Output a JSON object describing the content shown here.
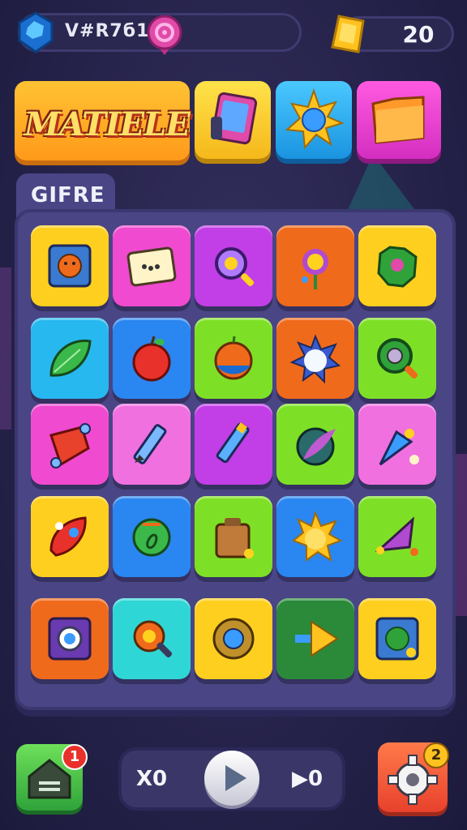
{
  "hud": {
    "player_code": "V#R7б1",
    "coins": "20"
  },
  "header": {
    "title": "MATIELE",
    "tabs": [
      {
        "icon": "tablet-icon",
        "color": "#ffd21f"
      },
      {
        "icon": "sun-icon",
        "color": "#2fb8f0"
      },
      {
        "icon": "folder-icon",
        "color": "#f04ad0"
      }
    ]
  },
  "panel": {
    "label": "GIFRE"
  },
  "grid": {
    "tiles": [
      {
        "icon": "monster-card-icon",
        "color": "#ffcf1f"
      },
      {
        "icon": "card-icon",
        "color": "#f04ad0"
      },
      {
        "icon": "magnifier-icon",
        "color": "#c23ee6"
      },
      {
        "icon": "flower-icon",
        "color": "#f06a1c"
      },
      {
        "icon": "green-monster-icon",
        "color": "#ffcf1f"
      },
      {
        "icon": "leaf-icon",
        "color": "#27b8f0"
      },
      {
        "icon": "apple-icon",
        "color": "#2a86f0"
      },
      {
        "icon": "tomato-icon",
        "color": "#7ee026"
      },
      {
        "icon": "star-burst-icon",
        "color": "#f06a1c"
      },
      {
        "icon": "green-magnifier-icon",
        "color": "#7ee026"
      },
      {
        "icon": "diamond-icon",
        "color": "#f04ad0"
      },
      {
        "icon": "pencil-icon",
        "color": "#f070e0"
      },
      {
        "icon": "blue-pencil-icon",
        "color": "#c23ee6"
      },
      {
        "icon": "feather-icon",
        "color": "#7ee026"
      },
      {
        "icon": "cone-icon",
        "color": "#f070e0"
      },
      {
        "icon": "rocket-icon",
        "color": "#ffcf1f"
      },
      {
        "icon": "green-orb-icon",
        "color": "#2a86f0"
      },
      {
        "icon": "box-icon",
        "color": "#7ee026"
      },
      {
        "icon": "sun-icon",
        "color": "#2a86f0"
      },
      {
        "icon": "purple-cone-icon",
        "color": "#7ee026"
      },
      {
        "icon": "frame-icon",
        "color": "#f06a1c"
      },
      {
        "icon": "gear-wrench-icon",
        "color": "#2fd6d6"
      },
      {
        "icon": "blue-gear-icon",
        "color": "#ffcf1f"
      },
      {
        "icon": "arrow-icon",
        "color": "#2a8a3a"
      },
      {
        "icon": "green-button-icon",
        "color": "#ffcf1f"
      }
    ]
  },
  "bottom": {
    "home_badge": "1",
    "left_control": "X0",
    "right_control": "▶0",
    "settings_badge": "2"
  }
}
